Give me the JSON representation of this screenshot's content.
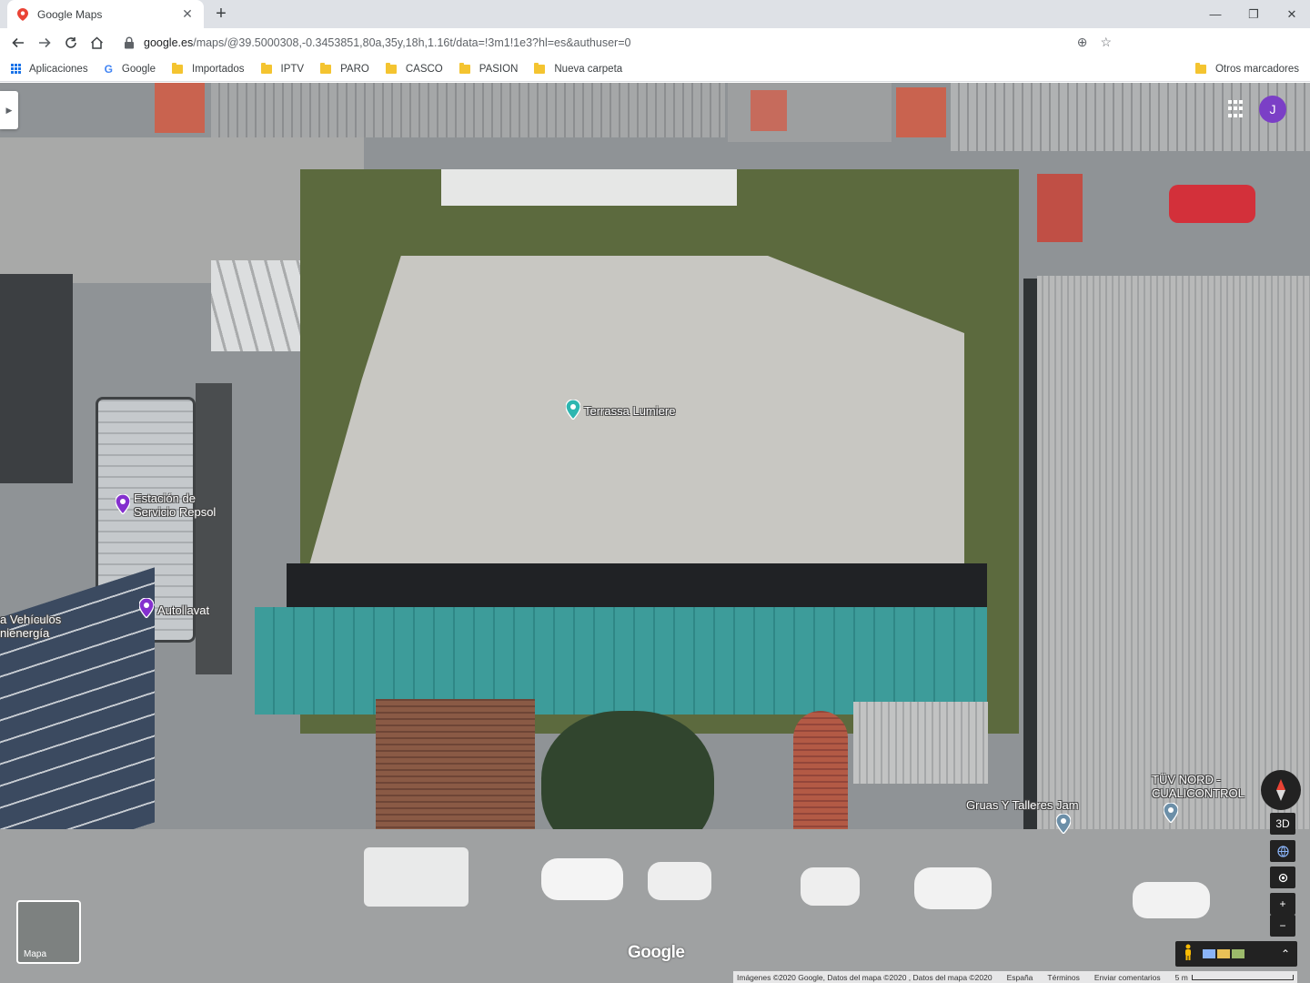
{
  "tab": {
    "title": "Google Maps"
  },
  "omnibox": {
    "url_host": "google.es",
    "url_path": "/maps/@39.5000308,-0.3453851,80a,35y,18h,1.16t/data=!3m1!1e3?hl=es&authuser=0"
  },
  "profile": {
    "initial": "J"
  },
  "bookmarks": {
    "apps_label": "Aplicaciones",
    "google_label": "Google",
    "items": [
      "Importados",
      "IPTV",
      "PARO",
      "CASCO",
      "PASION",
      "Nueva carpeta"
    ],
    "other_label": "Otros marcadores"
  },
  "map": {
    "places": {
      "terrassa": "Terrassa Lumiere",
      "repsol_line1": "Estación de",
      "repsol_line2": "Servicio Repsol",
      "autollavat": "Autollavat",
      "vehiculos_line1": "a Vehículos",
      "vehiculos_line2": "nienergía",
      "gruas": "Gruas Y Talleres Jam",
      "tuv_line1": "TÜV NORD -",
      "tuv_line2": "CUALICONTROL"
    },
    "controls": {
      "three_d": "3D",
      "zoom_in": "+",
      "zoom_out": "−"
    },
    "minimap_label": "Mapa",
    "watermark": "Google",
    "attribution": {
      "imagery": "Imágenes ©2020 Google, Datos del mapa ©2020 , Datos del mapa ©2020",
      "country": "España",
      "terms": "Términos",
      "feedback": "Enviar comentarios",
      "scale": "5 m"
    },
    "avatar_initial": "J"
  },
  "colors": {
    "accent": "#1a73e8",
    "profile": "#7b3fc6",
    "teal_roof": "#3d9c9a"
  }
}
